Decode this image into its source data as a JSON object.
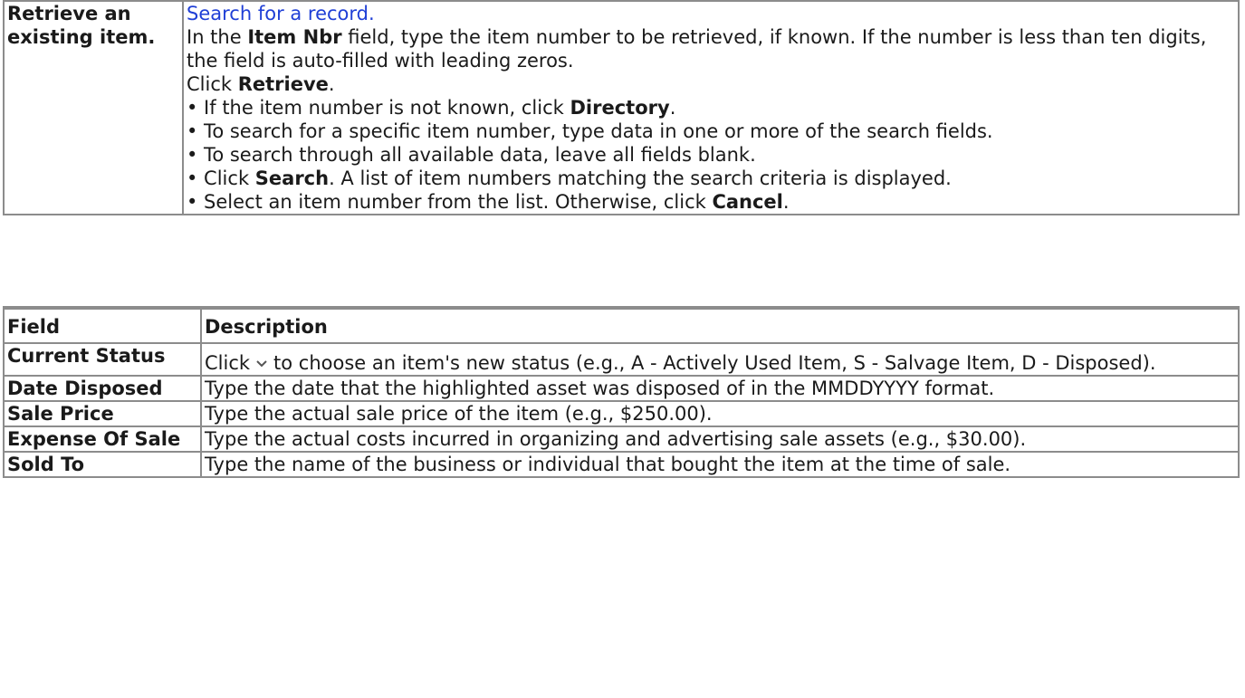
{
  "retrieve": {
    "label": "Retrieve an existing item.",
    "link": "Search for a record.",
    "p1_pre": "In the ",
    "p1_bold": "Item Nbr",
    "p1_post": " field, type the item number to be retrieved, if known. If the number is less than ten digits, the field is auto-filled with leading zeros.",
    "p2_pre": "Click ",
    "p2_bold": "Retrieve",
    "p2_post": ".",
    "b1_pre": "• If the item number is not known, click ",
    "b1_bold": "Directory",
    "b1_post": ".",
    "b2": "• To search for a specific item number, type data in one or more of the search fields.",
    "b3": "• To search through all available data, leave all fields blank.",
    "b4_pre": "• Click ",
    "b4_bold": "Search",
    "b4_post": ". A list of item numbers matching the search criteria is displayed.",
    "b5_pre": "• Select an item number from the list. Otherwise, click ",
    "b5_bold": "Cancel",
    "b5_post": "."
  },
  "fields_table": {
    "header_field": "Field",
    "header_description": "Description",
    "rows": [
      {
        "name": "Current Status",
        "desc_pre": "Click",
        "desc_icon": "chevron-down-icon",
        "desc_post": "to choose an item's new status (e.g., A - Actively Used Item, S - Salvage Item, D - Disposed)."
      },
      {
        "name": "Date Disposed",
        "desc": "Type the date that the highlighted asset was disposed of in the MMDDYYYY format."
      },
      {
        "name": "Sale Price",
        "desc": "Type the actual sale price of the item (e.g., $250.00)."
      },
      {
        "name": "Expense Of Sale",
        "desc": "Type the actual costs incurred in organizing and advertising sale assets (e.g., $30.00)."
      },
      {
        "name": "Sold To",
        "desc": "Type the name of the business or individual that bought the item at the time of sale."
      }
    ]
  }
}
